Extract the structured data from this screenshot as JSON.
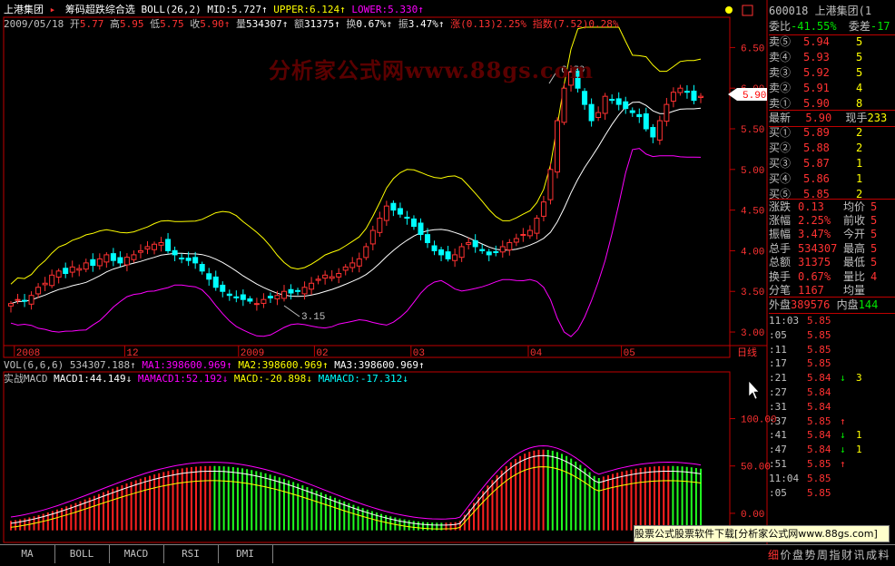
{
  "window": {
    "stock_name": "上港集团",
    "indicator_title": "筹码超跌综合选",
    "boll_params": "BOLL(26,2)",
    "mid_label": "MID:",
    "mid_value": "5.727",
    "upper_label": "UPPER:",
    "upper_value": "6.124",
    "lower_label": "LOWER:",
    "lower_value": "5.330"
  },
  "info_bar": {
    "date": "2009/05/18",
    "open_label": "开",
    "open": "5.77",
    "high_label": "高",
    "high": "5.95",
    "low_label": "低",
    "low": "5.75",
    "close_label": "收",
    "close": "5.90",
    "vol_label": "量",
    "vol": "534307",
    "amt_label": "额",
    "amt": "31375",
    "turn_label": "换",
    "turn": "0.67%",
    "amp_label": "振",
    "amp": "3.47%",
    "chg_label": "涨",
    "chg": "(0.13)2.25%",
    "idx_label": "指数",
    "idx": "(7.52)0.28%"
  },
  "watermark": "分析家公式网www.88gs.com",
  "annotations": {
    "high_mark": "6.29",
    "low_mark": "3.15"
  },
  "price_axis": [
    "6.50",
    "6.00",
    "5.50",
    "5.00",
    "4.50",
    "4.00",
    "3.50",
    "3.00"
  ],
  "current_price_tag": "5.90",
  "time_axis": [
    "2008",
    "12",
    "2009",
    "02",
    "03",
    "04",
    "05"
  ],
  "day_label": "日线",
  "vol_header": {
    "params": "VOL(6,6,6)",
    "vol": "534307.188",
    "ma1": "MA1:398600.969",
    "ma2": "MA2:398600.969",
    "ma3": "MA3:398600.969"
  },
  "macd_header": {
    "name": "实战MACD",
    "macd1": "MACD1:44.149",
    "mamacd1": "MAMACD1:52.192",
    "macd": "MACD:-20.898",
    "mamacd": "MAMACD:-17.312"
  },
  "macd_axis": [
    "100.00",
    "50.00",
    "0.00"
  ],
  "quote": {
    "code": "600018",
    "name": "上港集团(1",
    "wei_bi_label": "委比",
    "wei_bi": "-41.55%",
    "wei_cha_label": "委差",
    "wei_cha": "-17",
    "asks": [
      {
        "label": "卖⑤",
        "price": "5.94",
        "vol": "5"
      },
      {
        "label": "卖④",
        "price": "5.93",
        "vol": "5"
      },
      {
        "label": "卖③",
        "price": "5.92",
        "vol": "5"
      },
      {
        "label": "卖②",
        "price": "5.91",
        "vol": "4"
      },
      {
        "label": "卖①",
        "price": "5.90",
        "vol": "8"
      }
    ],
    "last_label": "最新",
    "last": "5.90",
    "vol_now_label": "现手",
    "vol_now": "233",
    "bids": [
      {
        "label": "买①",
        "price": "5.89",
        "vol": "2"
      },
      {
        "label": "买②",
        "price": "5.88",
        "vol": "2"
      },
      {
        "label": "买③",
        "price": "5.87",
        "vol": "1"
      },
      {
        "label": "买④",
        "price": "5.86",
        "vol": "1"
      },
      {
        "label": "买⑤",
        "price": "5.85",
        "vol": "2"
      }
    ],
    "stats": [
      {
        "l1": "涨跌",
        "v1": "0.13",
        "l2": "均价",
        "v2": "5"
      },
      {
        "l1": "涨幅",
        "v1": "2.25%",
        "l2": "前收",
        "v2": "5"
      },
      {
        "l1": "振幅",
        "v1": "3.47%",
        "l2": "今开",
        "v2": "5"
      },
      {
        "l1": "总手",
        "v1": "534307",
        "l2": "最高",
        "v2": "5"
      },
      {
        "l1": "总额",
        "v1": "31375",
        "l2": "最低",
        "v2": "5"
      },
      {
        "l1": "换手",
        "v1": "0.67%",
        "l2": "量比",
        "v2": "4"
      },
      {
        "l1": "分笔",
        "v1": "1167",
        "l2": "均量",
        "v2": ""
      }
    ],
    "outer_label": "外盘",
    "outer": "389576",
    "inner_label": "内盘",
    "inner": "144"
  },
  "ticks": [
    {
      "time": "11:03",
      "price": "5.85",
      "arrow": "",
      "vol": ""
    },
    {
      "time": ":05",
      "price": "5.85",
      "arrow": "",
      "vol": ""
    },
    {
      "time": ":11",
      "price": "5.85",
      "arrow": "",
      "vol": ""
    },
    {
      "time": ":17",
      "price": "5.85",
      "arrow": "",
      "vol": ""
    },
    {
      "time": ":21",
      "price": "5.84",
      "arrow": "↓",
      "vol": "3"
    },
    {
      "time": ":27",
      "price": "5.84",
      "arrow": "",
      "vol": ""
    },
    {
      "time": ":31",
      "price": "5.84",
      "arrow": "",
      "vol": ""
    },
    {
      "time": ":37",
      "price": "5.85",
      "arrow": "↑",
      "vol": ""
    },
    {
      "time": ":41",
      "price": "5.84",
      "arrow": "↓",
      "vol": "1"
    },
    {
      "time": ":47",
      "price": "5.84",
      "arrow": "↓",
      "vol": "1"
    },
    {
      "time": ":51",
      "price": "5.85",
      "arrow": "↑",
      "vol": ""
    },
    {
      "time": "11:04",
      "price": "5.85",
      "arrow": "",
      "vol": ""
    },
    {
      "time": ":05",
      "price": "5.85",
      "arrow": "",
      "vol": ""
    }
  ],
  "bottom_tabs": [
    "MA",
    "BOLL",
    "MACD",
    "RSI",
    "DMI"
  ],
  "right_tabs": [
    "细",
    "价",
    "盘",
    "势",
    "周",
    "指",
    "财",
    "讯",
    "成",
    "料"
  ],
  "ad_text": "股票公式股票软件下载[分析家公式网www.88gs.com]",
  "colors": {
    "up": "#ff3232",
    "down": "#00ffff",
    "upper": "#ffff00",
    "mid": "#ffffff",
    "lower": "#ff00ff",
    "macd_pos": "#ff2020",
    "macd_neg": "#20ff20"
  },
  "chart_data": {
    "type": "candlestick",
    "price_range": [
      2.9,
      6.75
    ],
    "candles_close": [
      3.35,
      3.4,
      3.38,
      3.45,
      3.55,
      3.6,
      3.7,
      3.75,
      3.72,
      3.8,
      3.78,
      3.85,
      3.82,
      3.9,
      3.95,
      3.88,
      3.85,
      3.92,
      3.95,
      4.0,
      4.05,
      4.08,
      4.1,
      4.0,
      3.95,
      3.9,
      3.88,
      3.85,
      3.75,
      3.65,
      3.55,
      3.5,
      3.45,
      3.42,
      3.4,
      3.38,
      3.35,
      3.4,
      3.42,
      3.45,
      3.5,
      3.48,
      3.5,
      3.55,
      3.6,
      3.65,
      3.7,
      3.68,
      3.72,
      3.8,
      3.85,
      3.9,
      4.05,
      4.25,
      4.4,
      4.55,
      4.5,
      4.45,
      4.4,
      4.3,
      4.2,
      4.1,
      4.0,
      3.95,
      3.9,
      3.95,
      4.05,
      4.1,
      4.05,
      4.0,
      3.95,
      3.98,
      4.05,
      4.1,
      4.15,
      4.2,
      4.25,
      4.4,
      4.6,
      5.0,
      5.6,
      6.0,
      6.2,
      6.0,
      5.8,
      5.6,
      5.7,
      5.9,
      5.85,
      5.8,
      5.75,
      5.7,
      5.65,
      5.5,
      5.4,
      5.6,
      5.8,
      5.95,
      6.0,
      5.95,
      5.85,
      5.9
    ],
    "boll_upper_end": 6.124,
    "boll_mid_end": 5.727,
    "boll_lower_end": 5.33,
    "macd_range": [
      -25,
      135
    ]
  }
}
